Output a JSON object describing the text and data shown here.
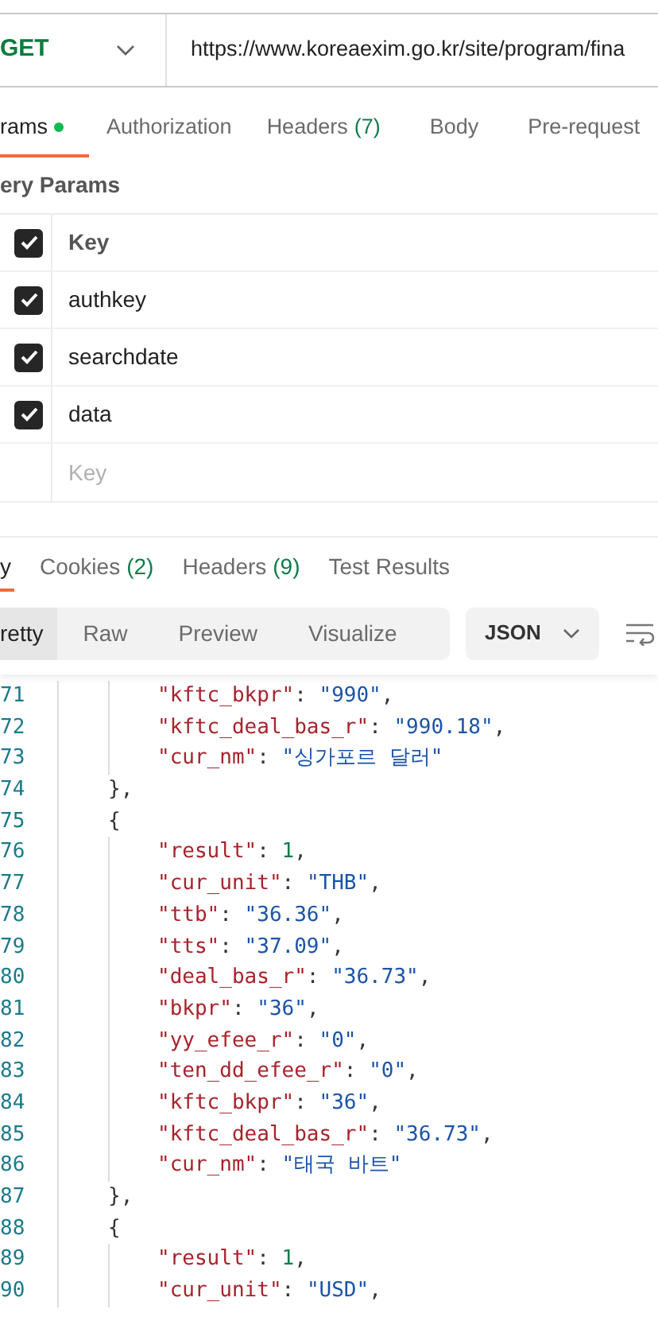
{
  "request": {
    "method": "GET",
    "url": "https://www.koreaexim.go.kr/site/program/fina"
  },
  "request_tabs": [
    {
      "label": "rams",
      "dot": true,
      "selected": true
    },
    {
      "label": "Authorization",
      "dot": false,
      "selected": false
    },
    {
      "label": "Headers",
      "count": "(7)",
      "dot": false,
      "selected": false
    },
    {
      "label": "Body",
      "dot": false,
      "selected": false
    },
    {
      "label": "Pre-request",
      "dot": false,
      "selected": false
    }
  ],
  "section_title": "ery Params",
  "params": {
    "header": {
      "key": "Key",
      "checked": true
    },
    "rows": [
      {
        "key": "authkey",
        "checked": true
      },
      {
        "key": "searchdate",
        "checked": true
      },
      {
        "key": "data",
        "checked": true
      }
    ],
    "placeholder": "Key"
  },
  "response_tabs": [
    {
      "label": "y",
      "selected": true
    },
    {
      "label": "Cookies",
      "count": "(2)",
      "selected": false
    },
    {
      "label": "Headers",
      "count": "(9)",
      "selected": false
    },
    {
      "label": "Test Results",
      "selected": false
    }
  ],
  "view_modes": [
    {
      "label": "retty",
      "selected": true
    },
    {
      "label": "Raw",
      "selected": false
    },
    {
      "label": "Preview",
      "selected": false
    },
    {
      "label": "Visualize",
      "selected": false
    }
  ],
  "format": "JSON",
  "code_lines": [
    {
      "number": "71",
      "kind": "member",
      "tokens": [
        {
          "kind": "key",
          "text": "\"kftc_bkpr\""
        },
        {
          "kind": "punct",
          "text": ": "
        },
        {
          "kind": "string",
          "text": "\"990\""
        },
        {
          "kind": "punct",
          "text": ","
        }
      ]
    },
    {
      "number": "72",
      "kind": "member",
      "tokens": [
        {
          "kind": "key",
          "text": "\"kftc_deal_bas_r\""
        },
        {
          "kind": "punct",
          "text": ": "
        },
        {
          "kind": "string",
          "text": "\"990.18\""
        },
        {
          "kind": "punct",
          "text": ","
        }
      ]
    },
    {
      "number": "73",
      "kind": "member",
      "tokens": [
        {
          "kind": "key",
          "text": "\"cur_nm\""
        },
        {
          "kind": "punct",
          "text": ": "
        },
        {
          "kind": "string",
          "text": "\"싱가포르 달러\""
        }
      ]
    },
    {
      "number": "74",
      "kind": "brace",
      "tokens": [
        {
          "kind": "punct",
          "text": "},"
        }
      ]
    },
    {
      "number": "75",
      "kind": "brace",
      "tokens": [
        {
          "kind": "punct",
          "text": "{"
        }
      ]
    },
    {
      "number": "76",
      "kind": "member",
      "tokens": [
        {
          "kind": "key",
          "text": "\"result\""
        },
        {
          "kind": "punct",
          "text": ": "
        },
        {
          "kind": "number",
          "text": "1"
        },
        {
          "kind": "punct",
          "text": ","
        }
      ]
    },
    {
      "number": "77",
      "kind": "member",
      "tokens": [
        {
          "kind": "key",
          "text": "\"cur_unit\""
        },
        {
          "kind": "punct",
          "text": ": "
        },
        {
          "kind": "string",
          "text": "\"THB\""
        },
        {
          "kind": "punct",
          "text": ","
        }
      ]
    },
    {
      "number": "78",
      "kind": "member",
      "tokens": [
        {
          "kind": "key",
          "text": "\"ttb\""
        },
        {
          "kind": "punct",
          "text": ": "
        },
        {
          "kind": "string",
          "text": "\"36.36\""
        },
        {
          "kind": "punct",
          "text": ","
        }
      ]
    },
    {
      "number": "79",
      "kind": "member",
      "tokens": [
        {
          "kind": "key",
          "text": "\"tts\""
        },
        {
          "kind": "punct",
          "text": ": "
        },
        {
          "kind": "string",
          "text": "\"37.09\""
        },
        {
          "kind": "punct",
          "text": ","
        }
      ]
    },
    {
      "number": "80",
      "kind": "member",
      "tokens": [
        {
          "kind": "key",
          "text": "\"deal_bas_r\""
        },
        {
          "kind": "punct",
          "text": ": "
        },
        {
          "kind": "string",
          "text": "\"36.73\""
        },
        {
          "kind": "punct",
          "text": ","
        }
      ]
    },
    {
      "number": "81",
      "kind": "member",
      "tokens": [
        {
          "kind": "key",
          "text": "\"bkpr\""
        },
        {
          "kind": "punct",
          "text": ": "
        },
        {
          "kind": "string",
          "text": "\"36\""
        },
        {
          "kind": "punct",
          "text": ","
        }
      ]
    },
    {
      "number": "82",
      "kind": "member",
      "tokens": [
        {
          "kind": "key",
          "text": "\"yy_efee_r\""
        },
        {
          "kind": "punct",
          "text": ": "
        },
        {
          "kind": "string",
          "text": "\"0\""
        },
        {
          "kind": "punct",
          "text": ","
        }
      ]
    },
    {
      "number": "83",
      "kind": "member",
      "tokens": [
        {
          "kind": "key",
          "text": "\"ten_dd_efee_r\""
        },
        {
          "kind": "punct",
          "text": ": "
        },
        {
          "kind": "string",
          "text": "\"0\""
        },
        {
          "kind": "punct",
          "text": ","
        }
      ]
    },
    {
      "number": "84",
      "kind": "member",
      "tokens": [
        {
          "kind": "key",
          "text": "\"kftc_bkpr\""
        },
        {
          "kind": "punct",
          "text": ": "
        },
        {
          "kind": "string",
          "text": "\"36\""
        },
        {
          "kind": "punct",
          "text": ","
        }
      ]
    },
    {
      "number": "85",
      "kind": "member",
      "tokens": [
        {
          "kind": "key",
          "text": "\"kftc_deal_bas_r\""
        },
        {
          "kind": "punct",
          "text": ": "
        },
        {
          "kind": "string",
          "text": "\"36.73\""
        },
        {
          "kind": "punct",
          "text": ","
        }
      ]
    },
    {
      "number": "86",
      "kind": "member",
      "tokens": [
        {
          "kind": "key",
          "text": "\"cur_nm\""
        },
        {
          "kind": "punct",
          "text": ": "
        },
        {
          "kind": "string",
          "text": "\"태국 바트\""
        }
      ]
    },
    {
      "number": "87",
      "kind": "brace",
      "tokens": [
        {
          "kind": "punct",
          "text": "},"
        }
      ]
    },
    {
      "number": "88",
      "kind": "brace",
      "tokens": [
        {
          "kind": "punct",
          "text": "{"
        }
      ]
    },
    {
      "number": "89",
      "kind": "member",
      "tokens": [
        {
          "kind": "key",
          "text": "\"result\""
        },
        {
          "kind": "punct",
          "text": ": "
        },
        {
          "kind": "number",
          "text": "1"
        },
        {
          "kind": "punct",
          "text": ","
        }
      ]
    },
    {
      "number": "90",
      "kind": "member",
      "tokens": [
        {
          "kind": "key",
          "text": "\"cur_unit\""
        },
        {
          "kind": "punct",
          "text": ": "
        },
        {
          "kind": "string",
          "text": "\"USD\""
        },
        {
          "kind": "punct",
          "text": ","
        }
      ]
    }
  ]
}
